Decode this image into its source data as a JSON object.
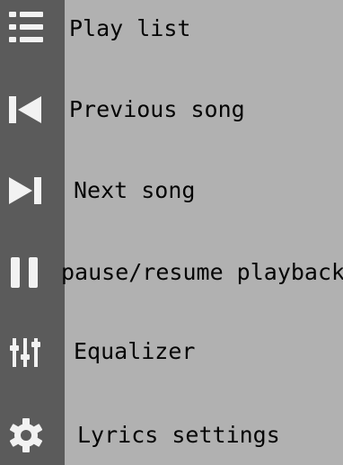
{
  "menu": {
    "items": [
      {
        "label": "Play list",
        "icon": "playlist-icon"
      },
      {
        "label": "Previous song",
        "icon": "skip-previous-icon"
      },
      {
        "label": "Next song",
        "icon": "skip-next-icon"
      },
      {
        "label": "pause/resume playback",
        "icon": "pause-icon"
      },
      {
        "label": "Equalizer",
        "icon": "equalizer-icon"
      },
      {
        "label": "Lyrics settings",
        "icon": "gear-icon"
      }
    ]
  },
  "colors": {
    "panel_bg": "#b1b1b1",
    "rail_bg": "#5b5b5b",
    "icon": "#f2f2f2",
    "text": "#050505"
  }
}
